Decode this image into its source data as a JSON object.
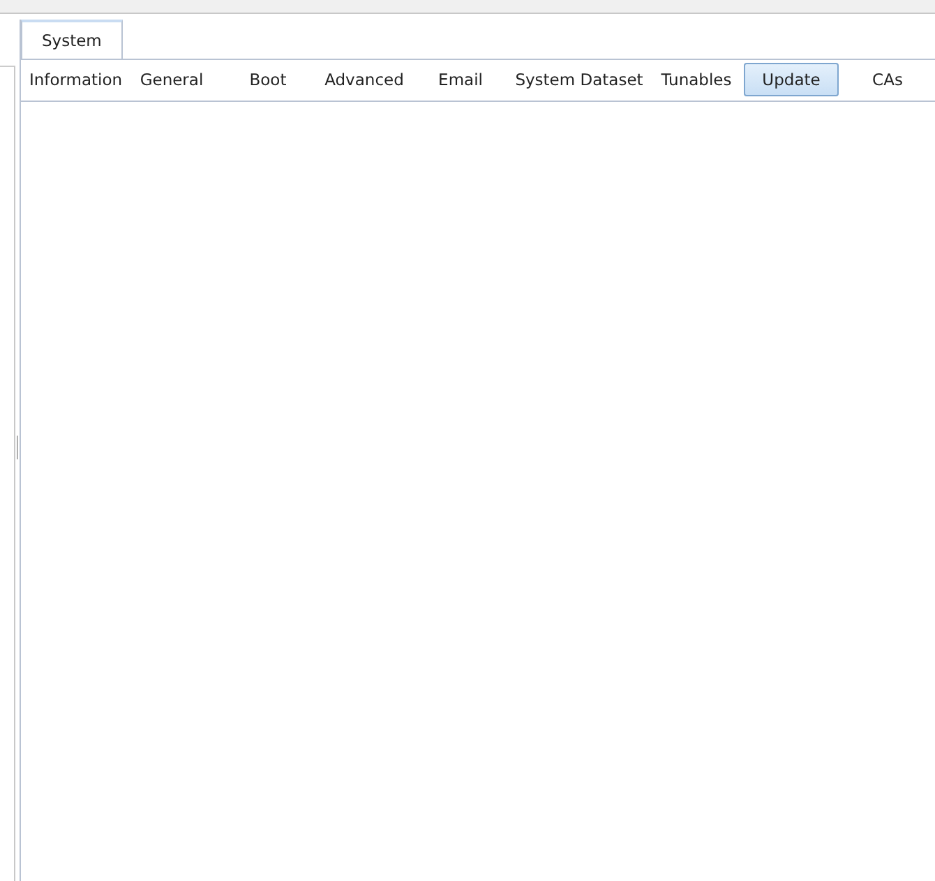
{
  "main_tabs": [
    {
      "label": "System",
      "selected": true
    }
  ],
  "sub_tabs": [
    {
      "label": "Information",
      "selected": false
    },
    {
      "label": "General",
      "selected": false
    },
    {
      "label": "Boot",
      "selected": false
    },
    {
      "label": "Advanced",
      "selected": false
    },
    {
      "label": "Email",
      "selected": false
    },
    {
      "label": "System Dataset",
      "selected": false
    },
    {
      "label": "Tunables",
      "selected": false
    },
    {
      "label": "Update",
      "selected": true
    },
    {
      "label": "CAs",
      "selected": false
    }
  ]
}
